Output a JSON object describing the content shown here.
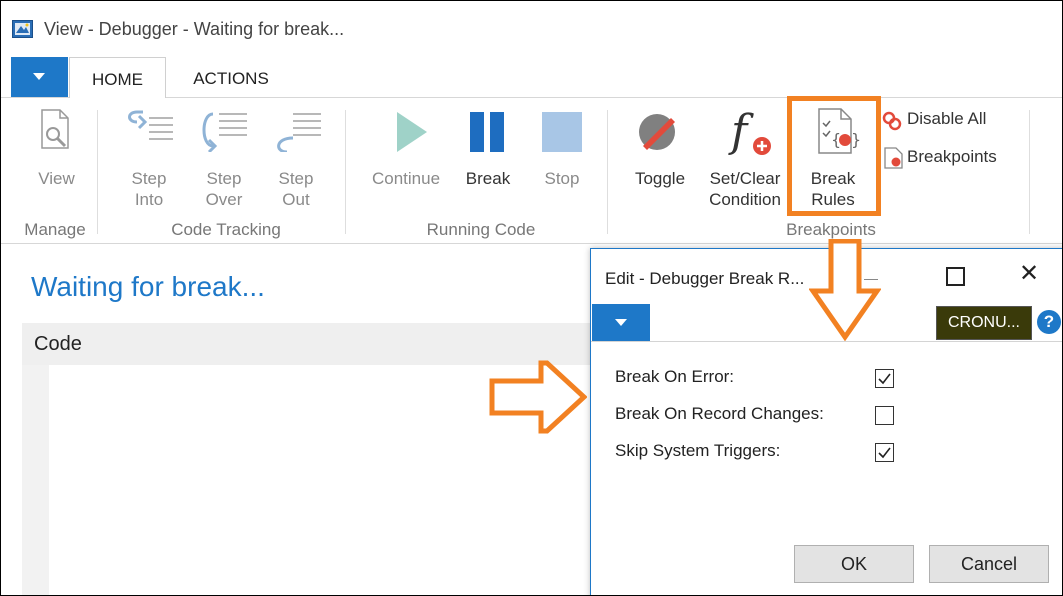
{
  "window": {
    "title": "View - Debugger - Waiting for break..."
  },
  "tabs": [
    {
      "label": "HOME"
    },
    {
      "label": "ACTIONS"
    }
  ],
  "ribbon": {
    "buttons": [
      {
        "label1": "View",
        "label2": ""
      },
      {
        "label1": "Step",
        "label2": "Into"
      },
      {
        "label1": "Step",
        "label2": "Over"
      },
      {
        "label1": "Step",
        "label2": "Out"
      },
      {
        "label1": "Continue",
        "label2": ""
      },
      {
        "label1": "Break",
        "label2": ""
      },
      {
        "label1": "Stop",
        "label2": ""
      },
      {
        "label1": "Toggle",
        "label2": ""
      },
      {
        "label1": "Set/Clear",
        "label2": "Condition"
      },
      {
        "label1": "Break",
        "label2": "Rules"
      }
    ],
    "small_buttons": [
      {
        "label": "Disable All"
      },
      {
        "label": "Breakpoints"
      }
    ],
    "groups": [
      "Manage",
      "Code Tracking",
      "Running Code",
      "Breakpoints"
    ]
  },
  "page": {
    "title": "Waiting for break...",
    "code_header": "Code"
  },
  "dialog": {
    "title": "Edit - Debugger Break R...",
    "company": "CRONU...",
    "help": "?",
    "fields": [
      {
        "label": "Break On Error:",
        "checked": true
      },
      {
        "label": "Break On Record Changes:",
        "checked": false
      },
      {
        "label": "Skip System Triggers:",
        "checked": true
      }
    ],
    "ok_label": "OK",
    "cancel_label": "Cancel"
  },
  "colors": {
    "accent": "#1e78c8",
    "highlight": "#f28122",
    "company_bg": "#3a3a0a"
  }
}
